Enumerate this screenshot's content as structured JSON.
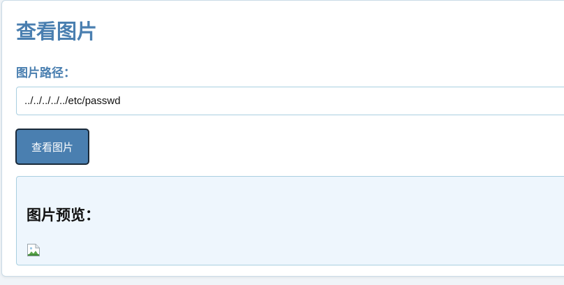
{
  "header": {
    "title": "查看图片"
  },
  "form": {
    "path_label": "图片路径：",
    "path_value": "../../../../../etc/passwd",
    "submit_label": "查看图片"
  },
  "preview": {
    "heading": "图片预览：",
    "image_icon": "broken-image-icon"
  },
  "colors": {
    "accent": "#4a7fb0",
    "panel_bg": "#eef6fd",
    "border": "#a9cfe0"
  }
}
